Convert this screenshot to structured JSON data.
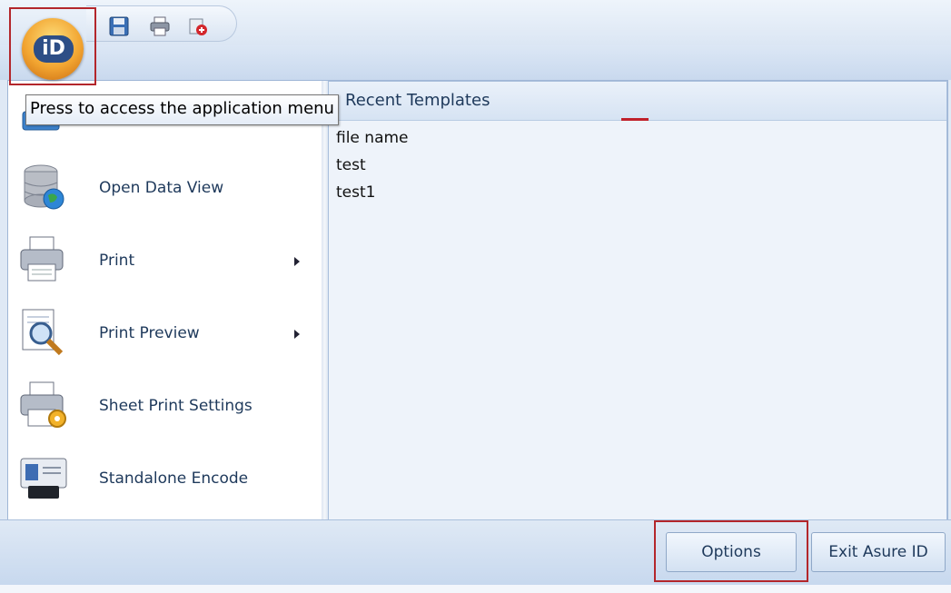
{
  "tooltip": {
    "text": "Press to access the application menu"
  },
  "app_orb": {
    "logo_text": "iD"
  },
  "quick_access": {
    "items": [
      {
        "icon": "save-icon"
      },
      {
        "icon": "print-icon"
      },
      {
        "icon": "undo-icon"
      }
    ]
  },
  "menu": {
    "items": [
      {
        "label": "Open Data View",
        "icon": "database-globe-icon",
        "has_submenu": false
      },
      {
        "label": "Print",
        "icon": "printer-icon",
        "has_submenu": true
      },
      {
        "label": "Print Preview",
        "icon": "print-preview-icon",
        "has_submenu": true
      },
      {
        "label": "Sheet Print Settings",
        "icon": "printer-settings-icon",
        "has_submenu": false
      },
      {
        "label": "Standalone Encode",
        "icon": "id-card-encode-icon",
        "has_submenu": false
      }
    ]
  },
  "recent": {
    "title": "Recent Templates",
    "items": [
      "file name",
      "test",
      "test1"
    ]
  },
  "footer": {
    "options_label": "Options",
    "exit_label": "Exit Asure ID"
  },
  "colors": {
    "highlight_border": "#b3262b",
    "accent": "#1e395b"
  }
}
